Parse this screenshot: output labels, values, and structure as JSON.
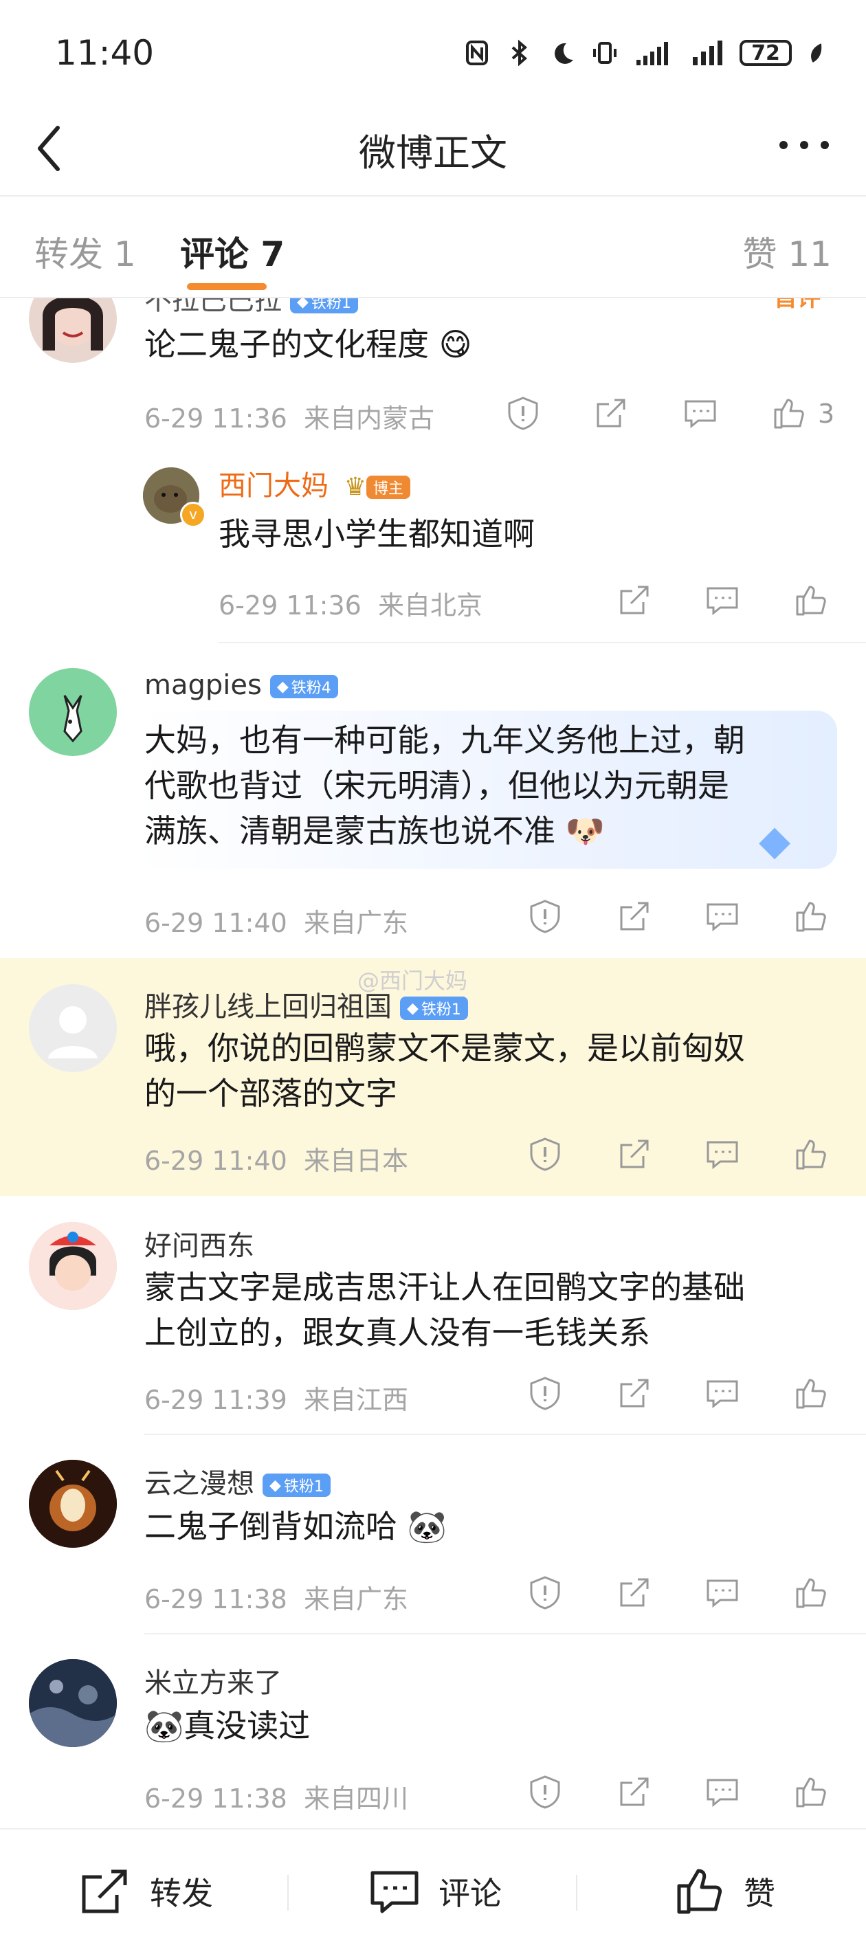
{
  "status_bar": {
    "time": "11:40",
    "battery": "72"
  },
  "nav": {
    "title": "微博正文"
  },
  "tabs": [
    {
      "label": "转发 1"
    },
    {
      "label": "评论 7"
    },
    {
      "label": "赞 11"
    }
  ],
  "watermark": "@西门大妈",
  "comments": [
    {
      "user": "不拉巴巴拉",
      "badge": "铁粉1",
      "top_tag": "首评",
      "text": "论二鬼子的文化程度",
      "time": "6-29 11:36",
      "location": "来自内蒙古",
      "likes": "3"
    },
    {
      "user": "西门大妈",
      "badge": "博主",
      "text": "我寻思小学生都知道啊",
      "time": "6-29 11:36",
      "location": "来自北京"
    },
    {
      "user": "magpies",
      "badge": "铁粉4",
      "text_lines": [
        "大妈，也有一种可能，九年义务他上过，朝",
        "代歌也背过（宋元明清），但他以为元朝是",
        "满族、清朝是蒙古族也说不准"
      ],
      "time": "6-29 11:40",
      "location": "来自广东"
    },
    {
      "user": "胖孩儿线上回归祖国",
      "badge": "铁粉1",
      "text_lines": [
        "哦，你说的回鹘蒙文不是蒙文，是以前匈奴",
        "的一个部落的文字"
      ],
      "time": "6-29 11:40",
      "location": "来自日本"
    },
    {
      "user": "好问西东",
      "text_lines": [
        "蒙古文字是成吉思汗让人在回鹘文字的基础",
        "上创立的，跟女真人没有一毛钱关系"
      ],
      "time": "6-29 11:39",
      "location": "来自江西"
    },
    {
      "user": "云之漫想",
      "badge": "铁粉1",
      "text": "二鬼子倒背如流哈",
      "time": "6-29 11:38",
      "location": "来自广东"
    },
    {
      "user": "米立方来了",
      "text": "真没读过",
      "time": "6-29 11:38",
      "location": "来自四川"
    }
  ],
  "bottom_bar": {
    "repost": "转发",
    "comment": "评论",
    "like": "赞"
  },
  "colors": {
    "accent": "#f58a2e",
    "highlight": "#fdf7dc",
    "badge": "#5b9ef5"
  }
}
